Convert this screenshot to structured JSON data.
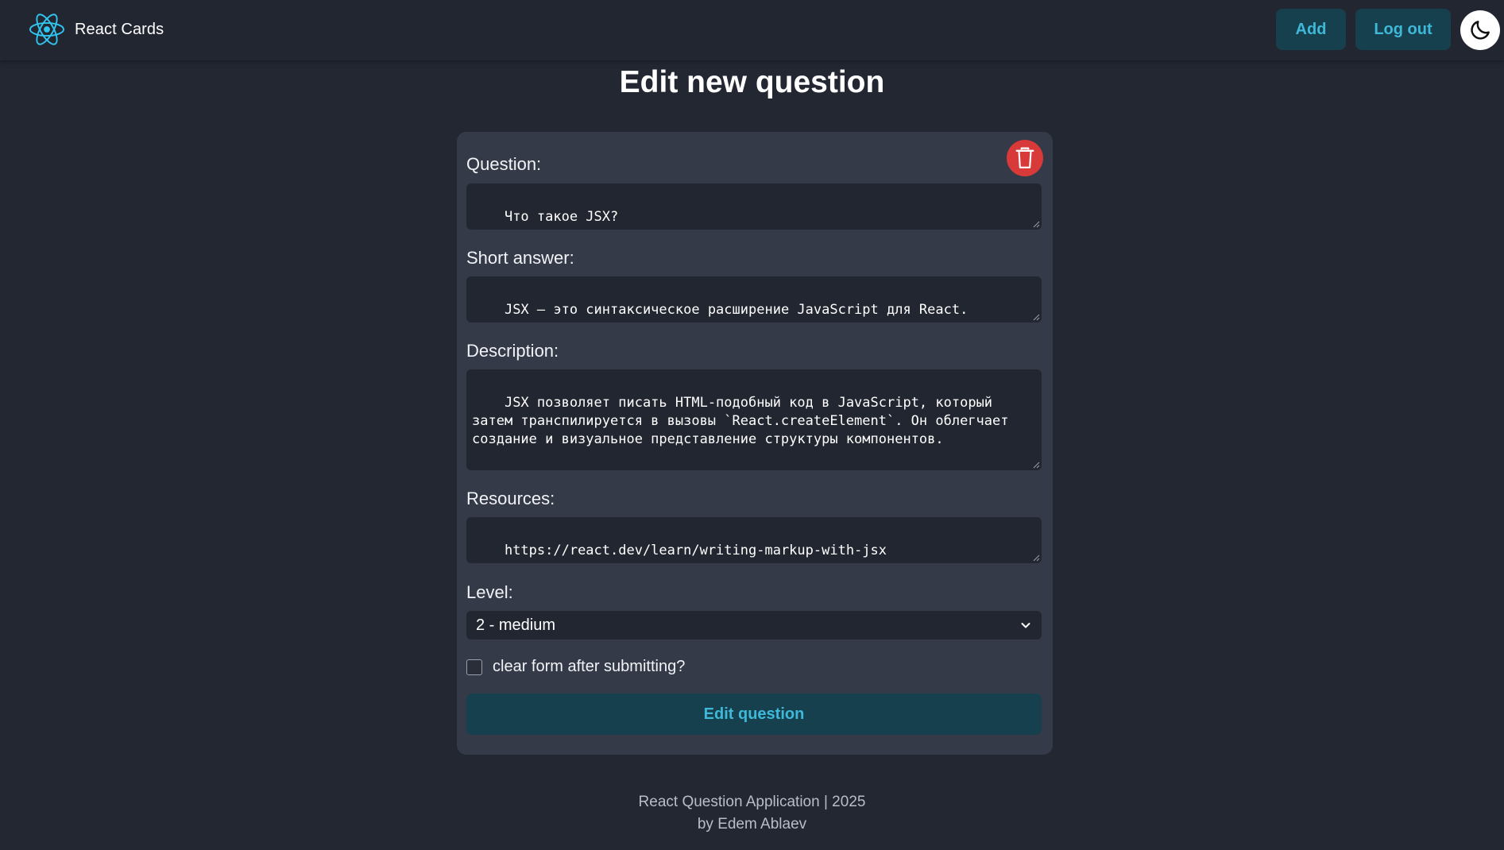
{
  "header": {
    "brand": "React Cards",
    "add_label": "Add",
    "logout_label": "Log out"
  },
  "page": {
    "title": "Edit new question"
  },
  "form": {
    "question_label": "Question:",
    "question_value": "Что такое JSX?",
    "short_answer_label": "Short answer:",
    "short_answer_value": "JSX — это синтаксическое расширение JavaScript для React.",
    "description_label": "Description:",
    "description_value": "JSX позволяет писать HTML-подобный код в JavaScript, который затем транспилируется в вызовы `React.createElement`. Он облегчает создание и визуальное представление структуры компонентов.",
    "resources_label": "Resources:",
    "resources_value": "https://react.dev/learn/writing-markup-with-jsx",
    "level_label": "Level:",
    "level_value": "2 - medium",
    "clear_form_label": "clear form after submitting?",
    "clear_form_checked": false,
    "submit_label": "Edit question"
  },
  "footer": {
    "line1": "React Question Application | 2025",
    "line2": "by Edem Ablaev"
  },
  "colors": {
    "background": "#232732",
    "card": "#353a48",
    "input": "#222630",
    "button_bg": "#16404d",
    "button_text": "#3fb9d9",
    "delete": "#d83a3a",
    "react_logo": "#30c4ee"
  },
  "icons": {
    "brand": "react-logo-icon",
    "theme": "moon-icon",
    "delete": "trash-icon",
    "select": "chevron-down-icon"
  }
}
